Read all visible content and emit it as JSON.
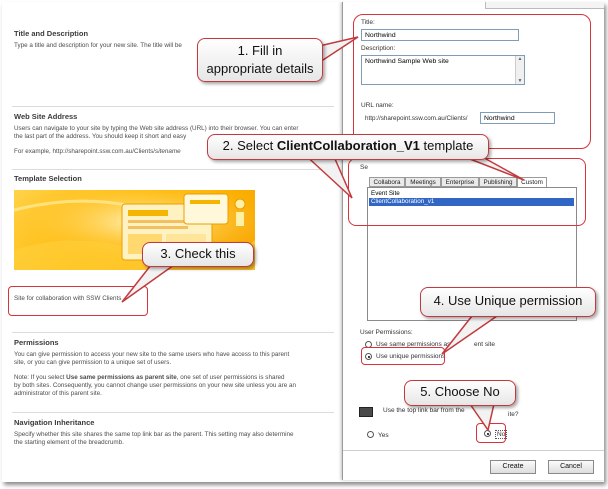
{
  "left": {
    "title_description": {
      "heading": "Title and Description",
      "text": "Type a title and description for your new site. The title will be"
    },
    "web_address": {
      "heading": "Web Site Address",
      "text1": "Users can navigate to your site by typing the Web site address (URL) into their browser. You can enter",
      "text2": "the last part of the address. You should keep it short and easy",
      "example_prefix": "For example, http://sharepoint.ssw.com.au/Clients/",
      "example_suffix": "sitename"
    },
    "template_selection": {
      "heading": "Template Selection",
      "caption": "Site for collaboration with SSW Clients"
    },
    "permissions": {
      "heading": "Permissions",
      "text1": "You can give permission to access your new site to the same users who have access to this parent",
      "text2": "site, or you can give permission to a unique set of users.",
      "note_prefix": "Note: If you select ",
      "note_bold": "Use same permissions as parent site",
      "note_rest1": ", one set of user permissions is shared",
      "note_rest2": "by both sites. Consequently, you cannot change user permissions on your new site unless you are an",
      "note_rest3": "administrator of this parent site."
    },
    "navigation": {
      "heading": "Navigation Inheritance",
      "text1": "Specify whether this site shares the same top link bar as the parent. This setting may also determine",
      "text2": "the starting element of the breadcrumb."
    }
  },
  "right": {
    "title_label": "Title:",
    "title_value": "Northwind",
    "description_label": "Description:",
    "description_value": "Northwind Sample Web site",
    "url_label": "URL name:",
    "url_prefix": "http://sharepoint.ssw.com.au/Clients/",
    "url_value": "Northwind",
    "select_label": "Se",
    "tabs": [
      "Collabora",
      "Meetings",
      "Enterprise",
      "Publishing",
      "Custom"
    ],
    "templates": [
      "Event Site",
      "ClientCollaboration_v1"
    ],
    "user_permissions_label": "User Permissions:",
    "perm_same": "Use same permissions as",
    "perm_same_tail": "ent site",
    "perm_unique": "Use unique permissions",
    "nav_question": "Use the top link bar from the",
    "nav_question_tail": "ite?",
    "nav_yes": "Yes",
    "nav_no": "No",
    "create_button": "Create",
    "cancel_button": "Cancel"
  },
  "callouts": {
    "c1_line1": "1. Fill in",
    "c1_line2": "appropriate details",
    "c2_prefix": "2. Select ",
    "c2_bold": "ClientCollaboration_V1",
    "c2_suffix": " template",
    "c3": "3. Check this",
    "c4": "4. Use Unique permission",
    "c5": "5. Choose No"
  },
  "colors": {
    "callout_border": "#c23a3e",
    "highlight_red": "#d8323a",
    "selected_blue": "#3166c4"
  }
}
